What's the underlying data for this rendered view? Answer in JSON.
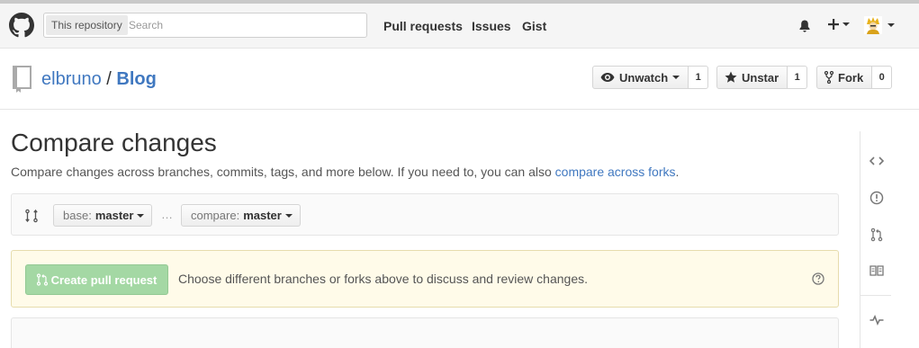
{
  "header": {
    "search_scope": "This repository",
    "search_placeholder": "Search",
    "nav": [
      "Pull requests",
      "Issues",
      "Gist"
    ],
    "icons": [
      "bell-icon",
      "plus-icon",
      "avatar"
    ]
  },
  "repo": {
    "owner": "elbruno",
    "separator": "/",
    "name": "Blog",
    "watch_label": "Unwatch",
    "watch_count": "1",
    "star_label": "Unstar",
    "star_count": "1",
    "fork_label": "Fork",
    "fork_count": "0"
  },
  "compare": {
    "title": "Compare changes",
    "description": "Compare changes across branches, commits, tags, and more below. If you need to, you can also",
    "forks_link": "compare across forks",
    "description_end": ".",
    "base_label": "base:",
    "base_value": "master",
    "ellipsis": "…",
    "compare_label": "compare:",
    "compare_value": "master"
  },
  "flash": {
    "button_label": "Create pull request",
    "message": "Choose different branches or forks above to discuss and review changes."
  },
  "colors": {
    "link": "#4078c0",
    "flash_bg": "#fffbe9",
    "disabled_green": "#a4d8a4"
  }
}
